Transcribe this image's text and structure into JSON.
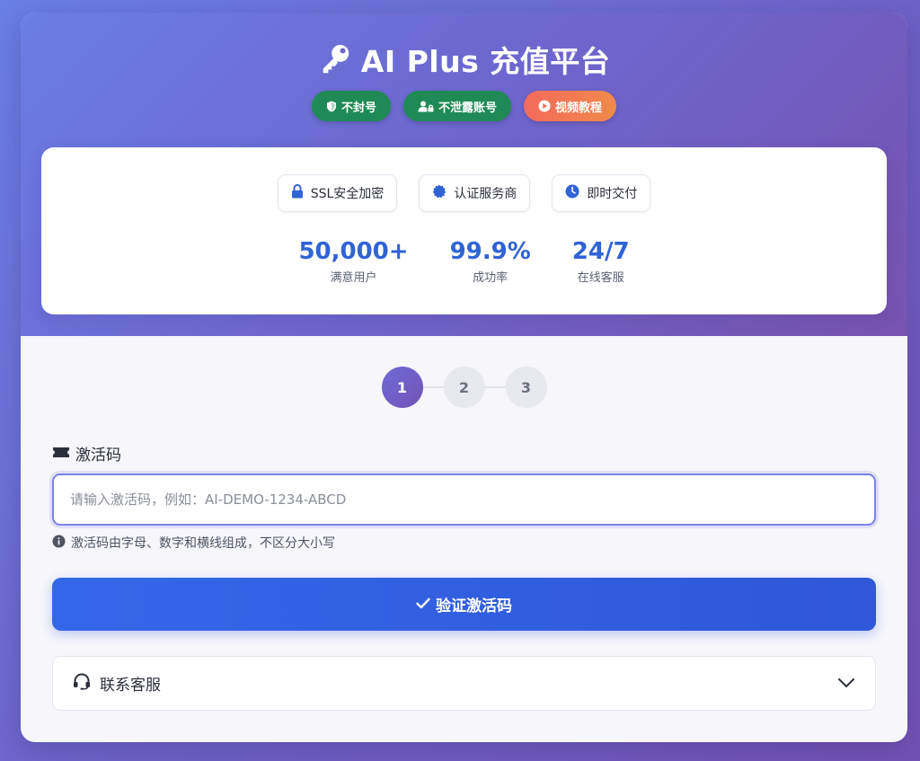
{
  "header": {
    "title": "AI Plus 充值平台",
    "title_icon": "key-icon",
    "badges": [
      {
        "label": "不封号",
        "icon": "shield-icon",
        "color": "#1f8a55"
      },
      {
        "label": "不泄露账号",
        "icon": "user-lock-icon",
        "color": "#1f8a55"
      },
      {
        "label": "视频教程",
        "icon": "play-circle-icon",
        "color": "#f36a5b"
      }
    ]
  },
  "trust": {
    "chips": [
      {
        "label": "SSL安全加密",
        "icon": "lock-icon"
      },
      {
        "label": "认证服务商",
        "icon": "certificate-icon"
      },
      {
        "label": "即时交付",
        "icon": "clock-icon"
      }
    ],
    "stats": [
      {
        "value": "50,000+",
        "label": "满意用户"
      },
      {
        "value": "99.9%",
        "label": "成功率"
      },
      {
        "value": "24/7",
        "label": "在线客服"
      }
    ]
  },
  "steps": {
    "items": [
      "1",
      "2",
      "3"
    ],
    "active": "1"
  },
  "form": {
    "label": "激活码",
    "label_icon": "ticket-icon",
    "value": "",
    "placeholder": "请输入激活码，例如：AI-DEMO-1234-ABCD",
    "hint": "激活码由字母、数字和横线组成，不区分大小写",
    "hint_icon": "info-circle-icon",
    "submit_label": "验证激活码",
    "submit_icon": "check-icon"
  },
  "support": {
    "label": "联系客服",
    "icon": "headset-icon",
    "toggle_icon": "chevron-down-icon"
  },
  "colors": {
    "accent_blue": "#2f63d6",
    "button_blue": "#3467e8",
    "badge_green": "#1f8a55",
    "badge_orange": "#f36a5b",
    "gradient_start": "#6a7ee4",
    "gradient_end": "#7653ae"
  }
}
